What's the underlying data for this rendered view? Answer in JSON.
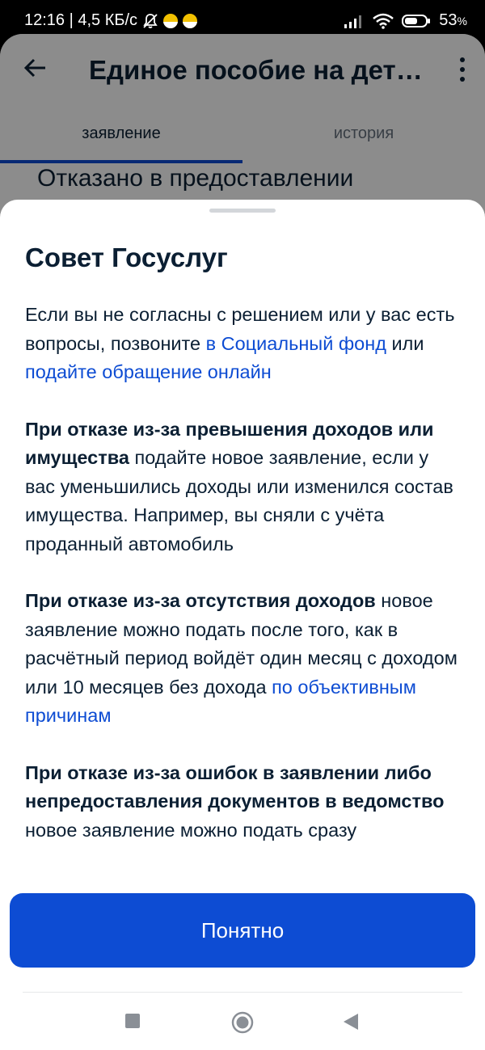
{
  "status_bar": {
    "time_info": "12:16 | 4,5 КБ/с",
    "battery": "53",
    "battery_unit": "%",
    "icons": [
      "bell-off-icon",
      "app-icon",
      "app-icon",
      "signal-icon",
      "wifi-icon",
      "battery-icon"
    ]
  },
  "app": {
    "title": "Единое пособие на дет…",
    "tabs": [
      {
        "label": "заявление",
        "active": true
      },
      {
        "label": "история",
        "active": false
      }
    ],
    "status_heading": "Отказано в предоставлении"
  },
  "sheet": {
    "title": "Совет Госуслуг",
    "p1": {
      "text_a": "Если вы не согласны с решением или у вас есть вопросы, позвоните ",
      "link_a": "в Социальный фонд",
      "text_b": " или ",
      "link_b": "подайте обращение онлайн"
    },
    "p2": {
      "bold": "При отказе из-за превышения доходов или имущества",
      "text": " подайте новое заявление, если у вас уменьшились доходы или изменился состав имущества. Например, вы сняли с учёта проданный автомобиль"
    },
    "p3": {
      "bold": "При отказе из-за отсутствия доходов",
      "text": " новое заявление можно подать после того, как в расчётный период войдёт один месяц с доходом или 10 месяцев без дохода ",
      "link": "по объективным причинам"
    },
    "p4": {
      "bold": "При отказе из-за ошибок в заявлении либо непредоставления документов в ведомство",
      "text": " новое заявление можно подать сразу"
    },
    "ok_label": "Понятно"
  },
  "colors": {
    "accent": "#0d4cd3",
    "text": "#0b1f33",
    "secondary_text": "#66727f"
  }
}
